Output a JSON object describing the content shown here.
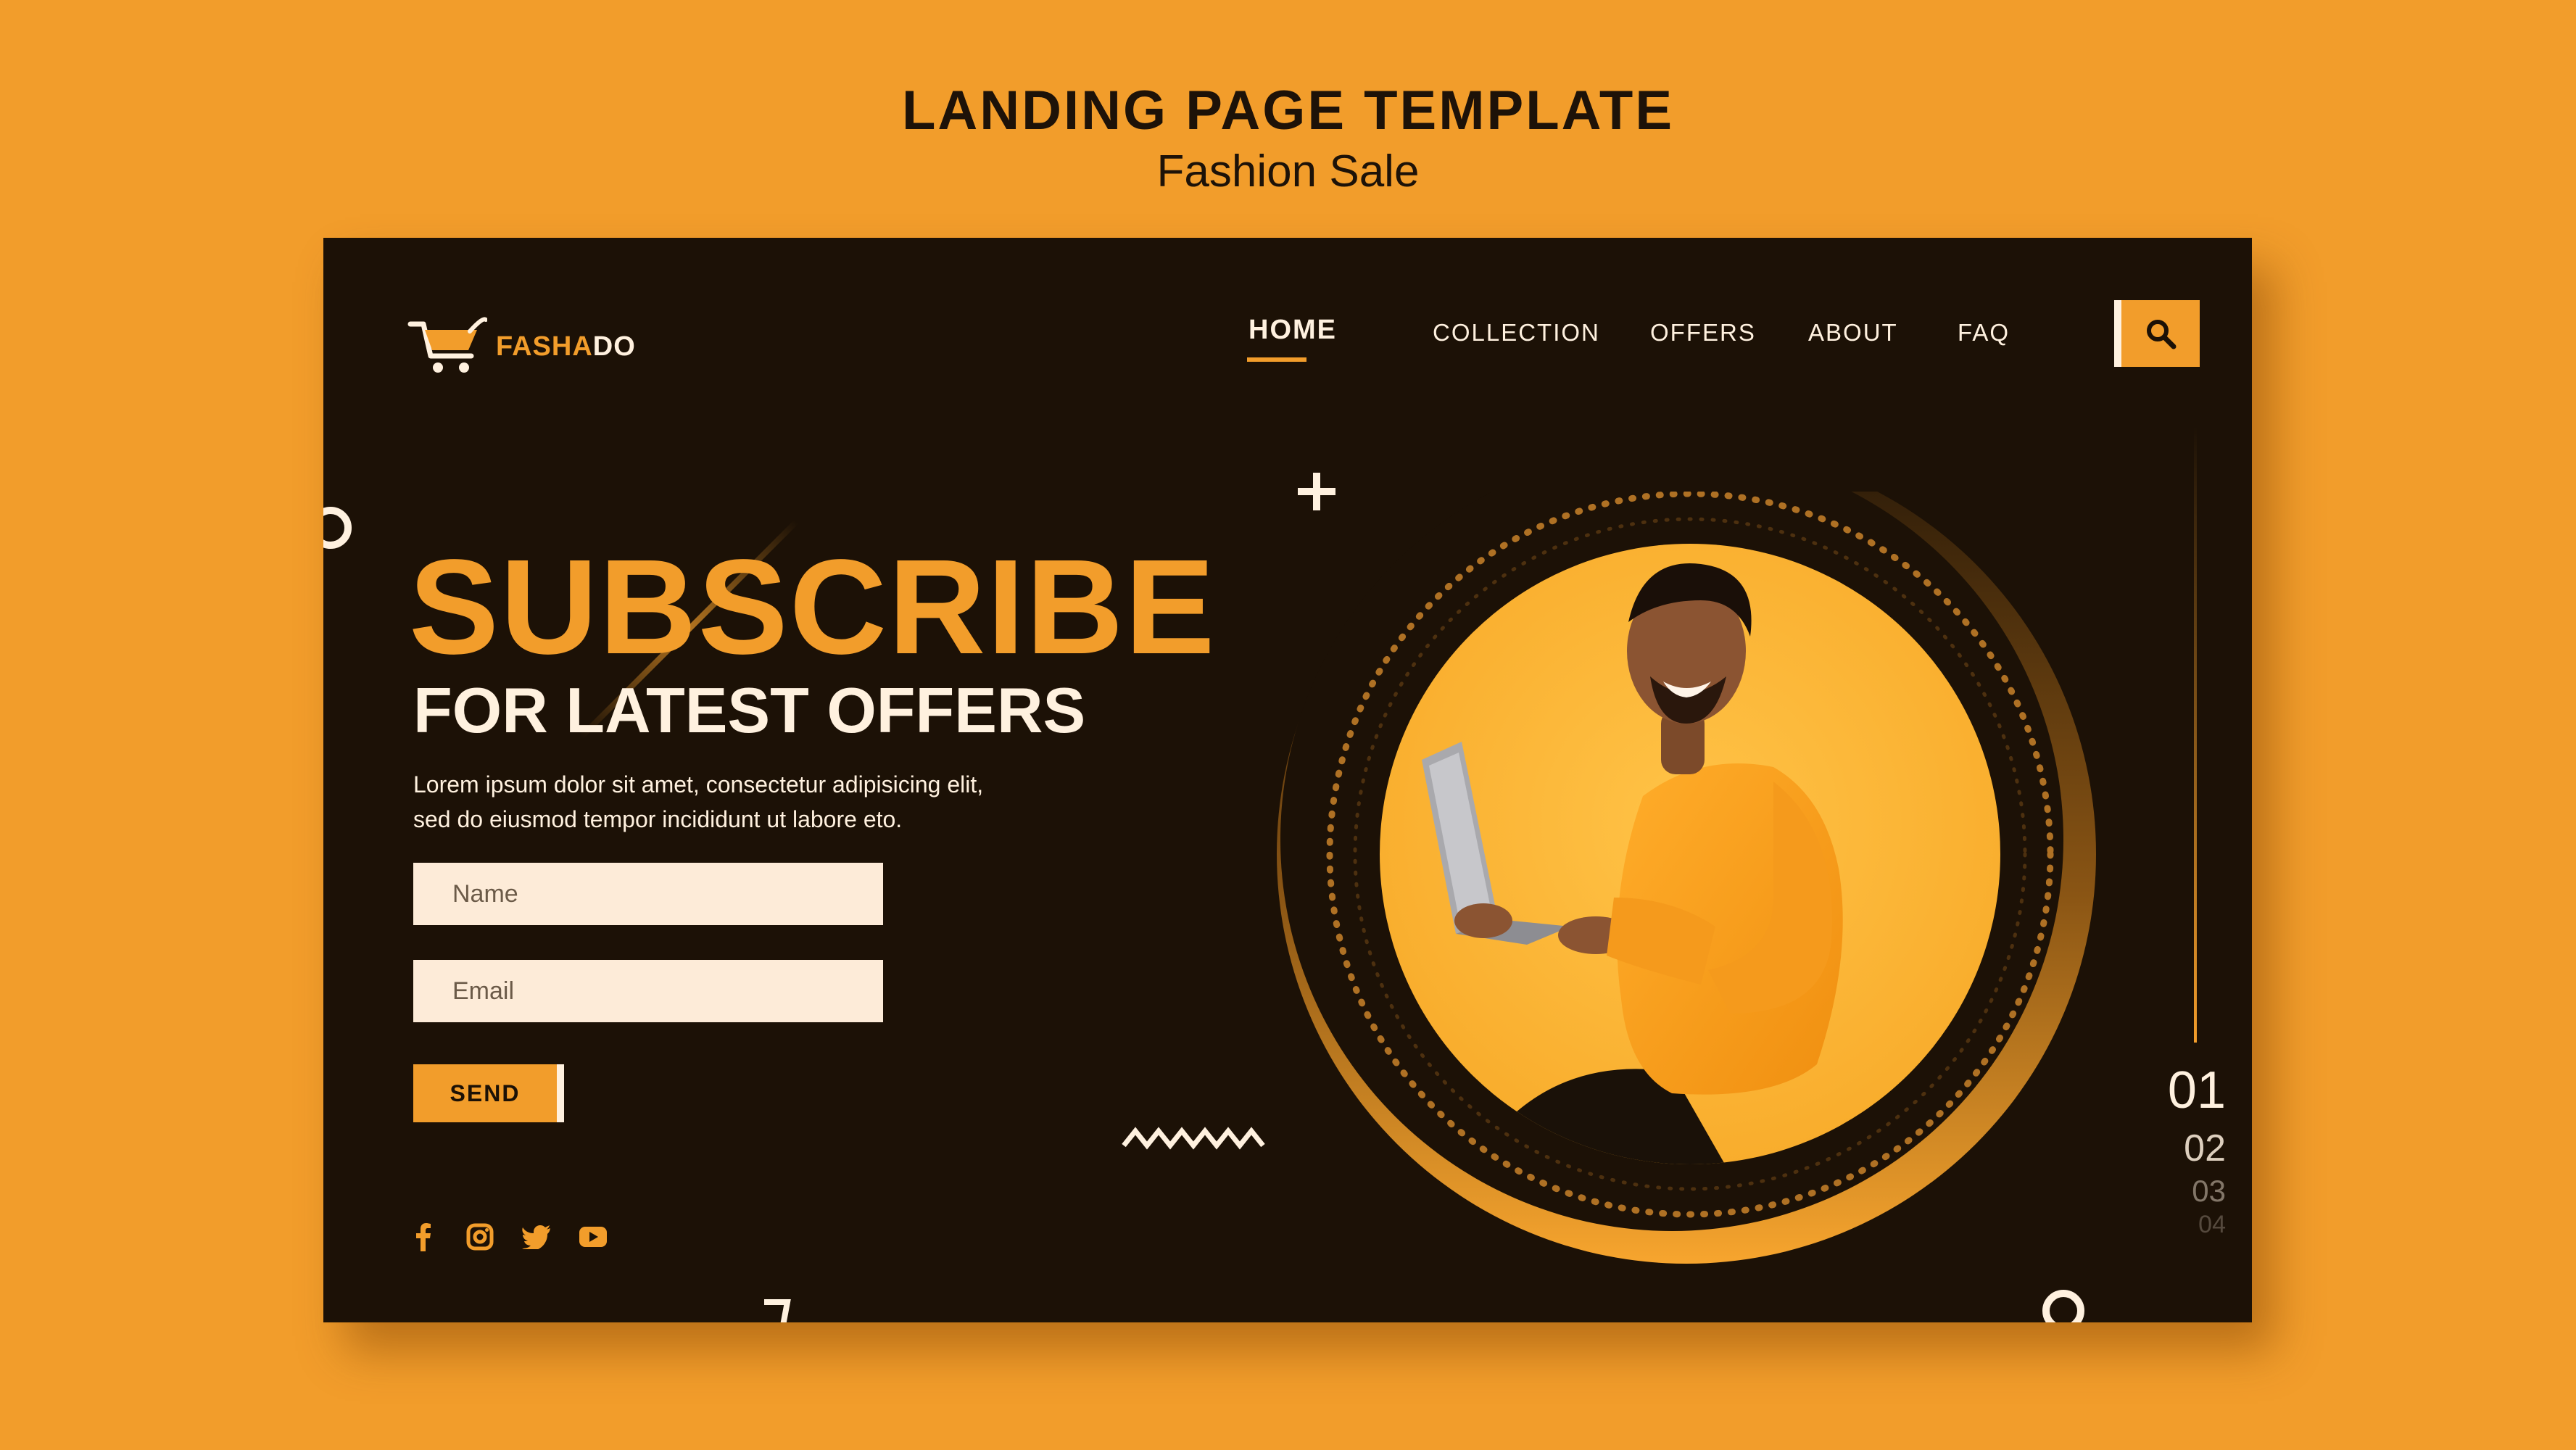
{
  "heading": {
    "title": "LANDING PAGE TEMPLATE",
    "subtitle": "Fashion Sale"
  },
  "logo": {
    "text_part1": "FASHA",
    "text_part2": "DO",
    "icon": "shopping-cart-icon"
  },
  "nav": {
    "items": [
      "HOME",
      "COLLECTION",
      "OFFERS",
      "ABOUT",
      "FAQ"
    ],
    "active": "HOME",
    "search_icon": "search-icon"
  },
  "hero": {
    "title": "SUBSCRIBE",
    "subtitle": "FOR LATEST OFFERS",
    "description_line1": "Lorem ipsum dolor sit amet, consectetur adipisicing elit,",
    "description_line2": "sed do eiusmod tempor incididunt ut labore eto."
  },
  "form": {
    "name_placeholder": "Name",
    "email_placeholder": "Email",
    "send_label": "SEND"
  },
  "socials": [
    "facebook-icon",
    "instagram-icon",
    "twitter-icon",
    "youtube-icon"
  ],
  "slides": [
    "01",
    "02",
    "03",
    "04"
  ],
  "colors": {
    "background": "#f29d2b",
    "panel": "#1c1106",
    "accent": "#f29d2b",
    "light": "#fff1df"
  }
}
